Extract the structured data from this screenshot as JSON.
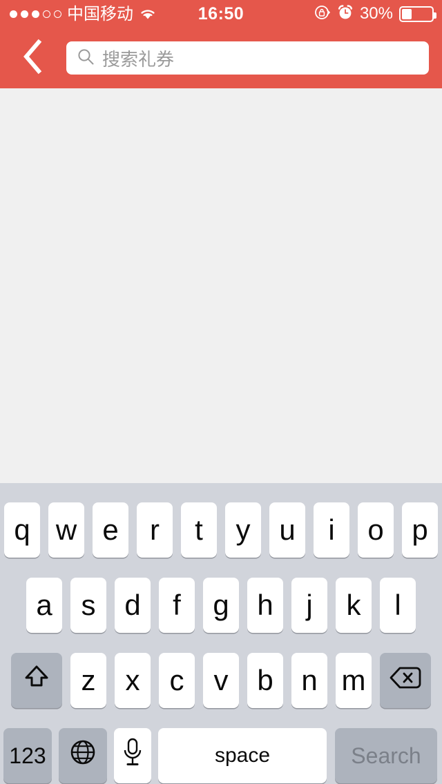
{
  "status_bar": {
    "signal_dots": [
      "filled",
      "filled",
      "filled",
      "empty",
      "empty"
    ],
    "carrier": "中国移动",
    "wifi_icon": "wifi-icon",
    "time": "16:50",
    "rotation_lock_icon": "rotation-lock-icon",
    "alarm_icon": "alarm-clock-icon",
    "battery_percent": "30%",
    "battery_level": 30,
    "background_color": "#e5574b"
  },
  "nav_bar": {
    "back_icon": "chevron-left-icon",
    "search": {
      "icon": "search-icon",
      "placeholder": "搜索礼券",
      "value": ""
    },
    "background_color": "#e5574b"
  },
  "content": {
    "background_color": "#f0f0f0",
    "items": []
  },
  "keyboard": {
    "background_color": "#d1d4db",
    "key_color": "#ffffff",
    "special_key_color": "#adb3bd",
    "layout": "qwerty-lowercase",
    "row1": [
      "q",
      "w",
      "e",
      "r",
      "t",
      "y",
      "u",
      "i",
      "o",
      "p"
    ],
    "row2": [
      "a",
      "s",
      "d",
      "f",
      "g",
      "h",
      "j",
      "k",
      "l"
    ],
    "row3_letters": [
      "z",
      "x",
      "c",
      "v",
      "b",
      "n",
      "m"
    ],
    "shift_icon": "shift-up-arrow-icon",
    "backspace_icon": "backspace-delete-icon",
    "numbers_key": "123",
    "globe_icon": "globe-icon",
    "microphone_icon": "microphone-icon",
    "space_key": "space",
    "return_key": "Search"
  }
}
